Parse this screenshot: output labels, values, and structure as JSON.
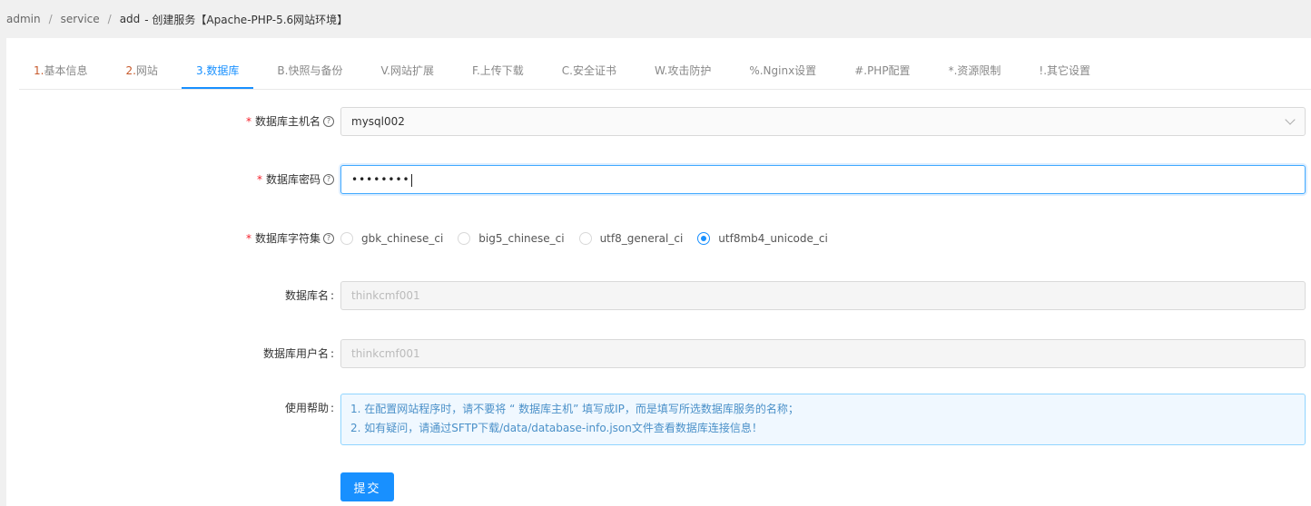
{
  "breadcrumb": {
    "items": [
      "admin",
      "service",
      "add"
    ],
    "separator": "/",
    "title": "- 创建服务【Apache-PHP-5.6网站环境】"
  },
  "tabs": [
    {
      "num": "1.",
      "label": "基本信息"
    },
    {
      "num": "2.",
      "label": "网站"
    },
    {
      "num": "3.",
      "label": "数据库"
    },
    {
      "num": "B.",
      "label": "快照与备份"
    },
    {
      "num": "V.",
      "label": "网站扩展"
    },
    {
      "num": "F.",
      "label": "上传下载"
    },
    {
      "num": "C.",
      "label": "安全证书"
    },
    {
      "num": "W.",
      "label": "攻击防护"
    },
    {
      "num": "%.",
      "label": "Nginx设置"
    },
    {
      "num": "#.",
      "label": "PHP配置"
    },
    {
      "num": "*.",
      "label": "资源限制"
    },
    {
      "num": "!.",
      "label": "其它设置"
    }
  ],
  "active_tab": "3.数据库",
  "form": {
    "db_host": {
      "label": "数据库主机名",
      "value": "mysql002"
    },
    "db_password": {
      "label": "数据库密码",
      "value": "••••••••"
    },
    "db_charset": {
      "label": "数据库字符集",
      "options": [
        "gbk_chinese_ci",
        "big5_chinese_ci",
        "utf8_general_ci",
        "utf8mb4_unicode_ci"
      ],
      "selected": "utf8mb4_unicode_ci"
    },
    "db_name": {
      "label": "数据库名",
      "value": "thinkcmf001"
    },
    "db_user": {
      "label": "数据库用户名",
      "value": "thinkcmf001"
    },
    "help": {
      "label": "使用帮助",
      "lines": [
        "1. 在配置网站程序时，请不要将 “ 数据库主机” 填写成IP，而是填写所选数据库服务的名称；",
        "2. 如有疑问，请通过SFTP下载/data/database-info.json文件查看数据库连接信息！"
      ]
    },
    "submit_label": "提交"
  },
  "colors": {
    "primary": "#1890ff",
    "required": "#f5222d",
    "tab_num": "#c75a2c"
  }
}
